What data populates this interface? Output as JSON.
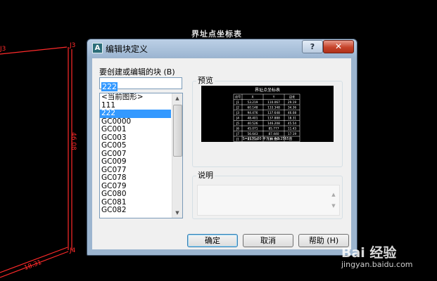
{
  "cad": {
    "title": "界址点坐标表",
    "label_j3": "J3",
    "label_j4": "J4",
    "label_left": "J3",
    "dim_vertical": "46.08",
    "dim_bottom": "18.31",
    "line_color": "#ff2a2a"
  },
  "dialog": {
    "title": "编辑块定义",
    "help_glyph": "?",
    "close_glyph": "✕",
    "app_icon": "autocad-icon",
    "block_name_label": "要创建或编辑的块 (B)",
    "block_name_value": "222",
    "blocks": [
      "<当前图形>",
      "111",
      "222",
      "GC0000",
      "GC001",
      "GC003",
      "GC005",
      "GC007",
      "GC009",
      "GC077",
      "GC078",
      "GC079",
      "GC080",
      "GC081",
      "GC082"
    ],
    "selected_block": "222",
    "preview_label": "预览",
    "description_label": "说明",
    "ok_label": "确定",
    "cancel_label": "取消",
    "help_label": "帮助 (H)",
    "accent_color": "#3399ff"
  },
  "preview_table": {
    "title": "界址点坐标表",
    "headers": [
      "点号",
      "X",
      "Y",
      "边长"
    ],
    "rows": [
      [
        "J1",
        "53.219",
        "110.067",
        "29.19"
      ],
      [
        "J2",
        "60.148",
        "133.348",
        "34.36"
      ],
      [
        "J3",
        "94.476",
        "137.648",
        "46.08"
      ],
      [
        "J4",
        "48.401",
        "137.888",
        "18.31"
      ],
      [
        "J5",
        "40.526",
        "146.208",
        "45.54"
      ],
      [
        "J6",
        "45.071",
        "85.777",
        "11.43"
      ],
      [
        "J7",
        "56.643",
        "87.440",
        "17.19"
      ],
      [
        "J1",
        "53.219",
        "110.067",
        ""
      ]
    ],
    "footer": "S=2171.00 平方米 合3.2565亩"
  },
  "watermark": {
    "brand": "Bai 经验",
    "url": "jingyan.baidu.com"
  }
}
